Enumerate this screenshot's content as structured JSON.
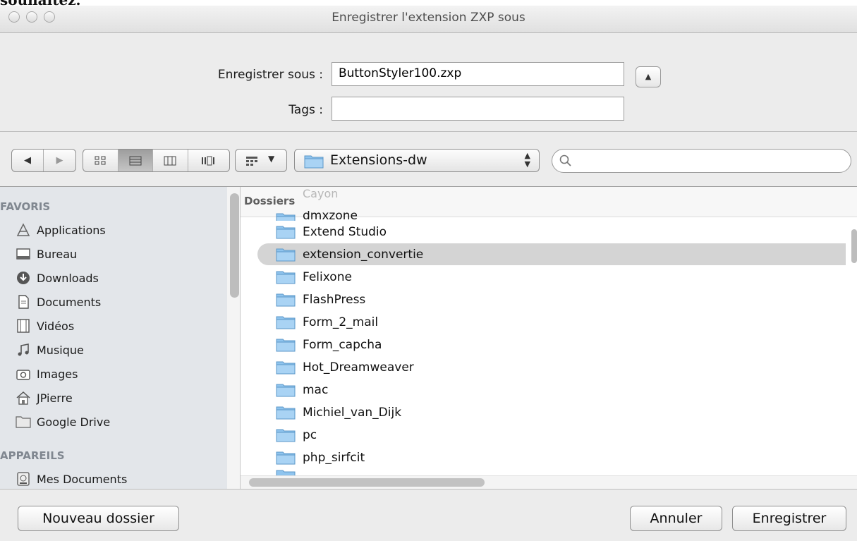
{
  "doc_caption": "souhaitez.",
  "window": {
    "title": "Enregistrer l'extension ZXP sous"
  },
  "save": {
    "name_label": "Enregistrer sous :",
    "name_value": "ButtonStyler100.zxp",
    "tags_label": "Tags :",
    "tags_value": ""
  },
  "toolbar": {
    "location": "Extensions-dw",
    "search_placeholder": "",
    "view_mode": "list"
  },
  "sidebar": {
    "favorites_header": "FAVORIS",
    "favorites": [
      {
        "label": "Applications",
        "icon": "applications-icon"
      },
      {
        "label": "Bureau",
        "icon": "desktop-icon"
      },
      {
        "label": "Downloads",
        "icon": "downloads-icon"
      },
      {
        "label": "Documents",
        "icon": "documents-icon"
      },
      {
        "label": "Vidéos",
        "icon": "videos-icon"
      },
      {
        "label": "Musique",
        "icon": "music-icon"
      },
      {
        "label": "Images",
        "icon": "camera-icon"
      },
      {
        "label": "JPierre",
        "icon": "home-icon"
      },
      {
        "label": "Google Drive",
        "icon": "folder-icon"
      }
    ],
    "devices_header": "APPAREILS",
    "devices": [
      {
        "label": "Mes Documents",
        "icon": "disk-icon"
      }
    ]
  },
  "browser": {
    "header": "Dossiers",
    "ghost_item": "Cayon",
    "partial_top": "dmxzone",
    "folders": [
      {
        "name": "Extend Studio",
        "selected": false
      },
      {
        "name": "extension_convertie",
        "selected": true
      },
      {
        "name": "Felixone",
        "selected": false
      },
      {
        "name": "FlashPress",
        "selected": false
      },
      {
        "name": "Form_2_mail",
        "selected": false
      },
      {
        "name": "Form_capcha",
        "selected": false
      },
      {
        "name": "Hot_Dreamweaver",
        "selected": false
      },
      {
        "name": "mac",
        "selected": false
      },
      {
        "name": "Michiel_van_Dijk",
        "selected": false
      },
      {
        "name": "pc",
        "selected": false
      },
      {
        "name": "php_sirfcit",
        "selected": false
      }
    ]
  },
  "buttons": {
    "new_folder": "Nouveau dossier",
    "cancel": "Annuler",
    "save": "Enregistrer"
  },
  "colors": {
    "selection": "#d4d4d4",
    "sidebar_bg": "#e3e6ea",
    "window_bg": "#ececec"
  }
}
